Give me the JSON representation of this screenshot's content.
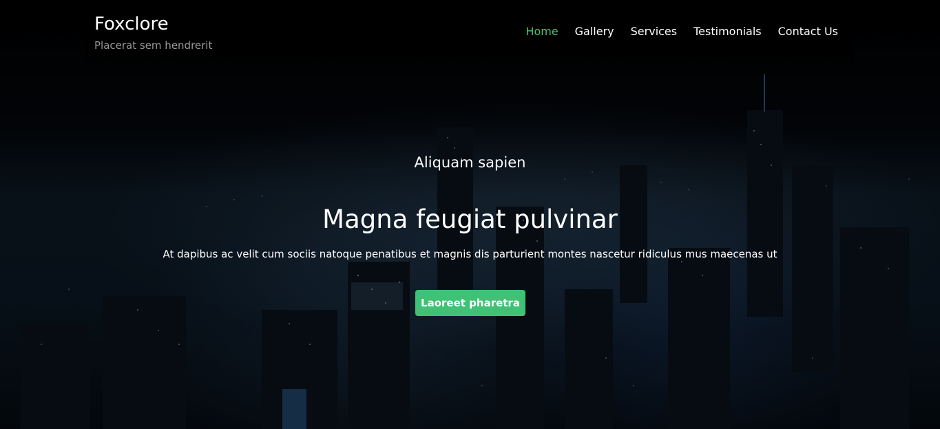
{
  "brand": {
    "title": "Foxclore",
    "tagline": "Placerat sem hendrerit"
  },
  "nav": {
    "items": [
      {
        "label": "Home",
        "active": true
      },
      {
        "label": "Gallery",
        "active": false
      },
      {
        "label": "Services",
        "active": false
      },
      {
        "label": "Testimonials",
        "active": false
      },
      {
        "label": "Contact Us",
        "active": false
      }
    ]
  },
  "hero": {
    "kicker": "Aliquam sapien",
    "headline": "Magna feugiat pulvinar",
    "subtext": "At dapibus ac velit cum sociis natoque penatibus et magnis dis parturient montes nascetur ridiculus mus maecenas ut",
    "cta_label": "Laoreet pharetra"
  },
  "colors": {
    "accent": "#3fc275",
    "nav_active": "#4cc073",
    "tagline": "#9a9a9a"
  }
}
